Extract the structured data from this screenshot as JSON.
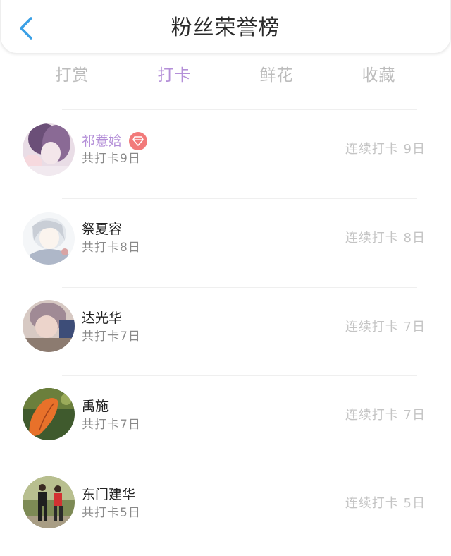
{
  "header": {
    "title": "粉丝荣誉榜",
    "back_icon": "chevron-left-icon",
    "accent_color": "#3aa0e6"
  },
  "tabs": [
    {
      "label": "打赏",
      "active": false
    },
    {
      "label": "打卡",
      "active": true
    },
    {
      "label": "鲜花",
      "active": false
    },
    {
      "label": "收藏",
      "active": false
    }
  ],
  "colors": {
    "active_tab": "#b48fd8",
    "inactive_tab": "#bdbdbd",
    "badge": "#f27a7a"
  },
  "fans": [
    {
      "name": "祁薏娢",
      "total": "共打卡9日",
      "streak": "连续打卡 9日",
      "highlight": true,
      "badge_icon": "diamond-icon"
    },
    {
      "name": "祭夏容",
      "total": "共打卡8日",
      "streak": "连续打卡 8日",
      "highlight": false
    },
    {
      "name": "达光华",
      "total": "共打卡7日",
      "streak": "连续打卡 7日",
      "highlight": false
    },
    {
      "name": "禹施",
      "total": "共打卡7日",
      "streak": "连续打卡 7日",
      "highlight": false
    },
    {
      "name": "东门建华",
      "total": "共打卡5日",
      "streak": "连续打卡 5日",
      "highlight": false
    }
  ]
}
